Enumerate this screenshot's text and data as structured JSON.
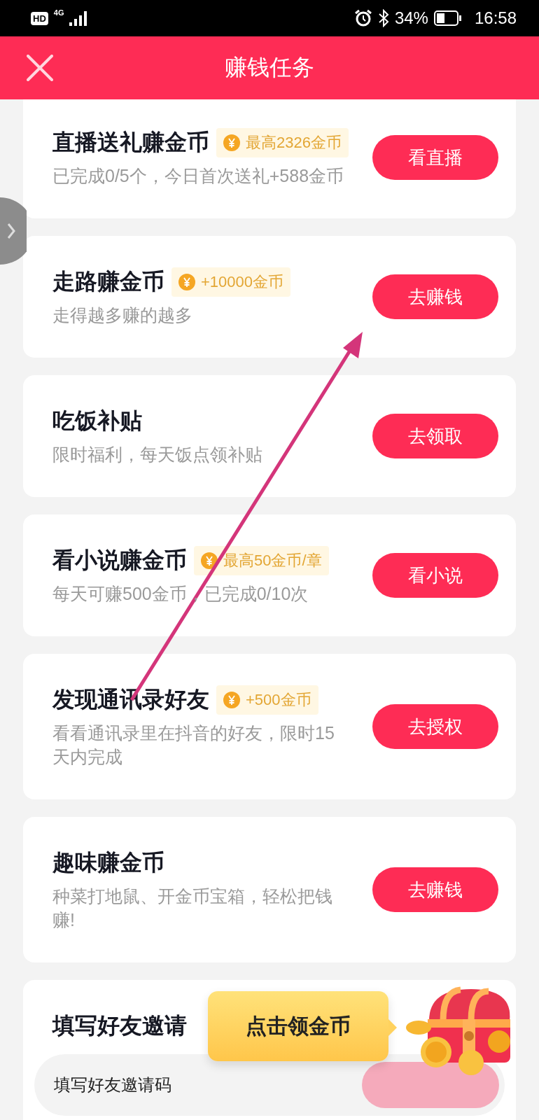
{
  "status_bar": {
    "hd": "HD",
    "network": "4G",
    "battery": "34%",
    "time": "16:58"
  },
  "header": {
    "title": "赚钱任务"
  },
  "tasks": [
    {
      "title": "直播送礼赚金币",
      "badge": "最高2326金币",
      "subtitle": "已完成0/5个，今日首次送礼+588金币",
      "button": "看直播"
    },
    {
      "title": "走路赚金币",
      "badge": "+10000金币",
      "subtitle": "走得越多赚的越多",
      "button": "去赚钱"
    },
    {
      "title": "吃饭补贴",
      "subtitle": "限时福利，每天饭点领补贴",
      "button": "去领取"
    },
    {
      "title": "看小说赚金币",
      "badge": "最高50金币/章",
      "subtitle": "每天可赚500金币，已完成0/10次",
      "button": "看小说"
    },
    {
      "title": "发现通讯录好友",
      "badge": "+500金币",
      "subtitle": "看看通讯录里在抖音的好友，限时15天内完成",
      "button": "去授权"
    },
    {
      "title": "趣味赚金币",
      "subtitle": "种菜打地鼠、开金币宝箱，轻松把钱赚!",
      "button": "去赚钱"
    }
  ],
  "invite": {
    "title": "填写好友邀请",
    "field": {
      "placeholder": "填写好友邀请码"
    },
    "submit": {
      "disabled": true
    },
    "tooltip": "点击领金币"
  }
}
